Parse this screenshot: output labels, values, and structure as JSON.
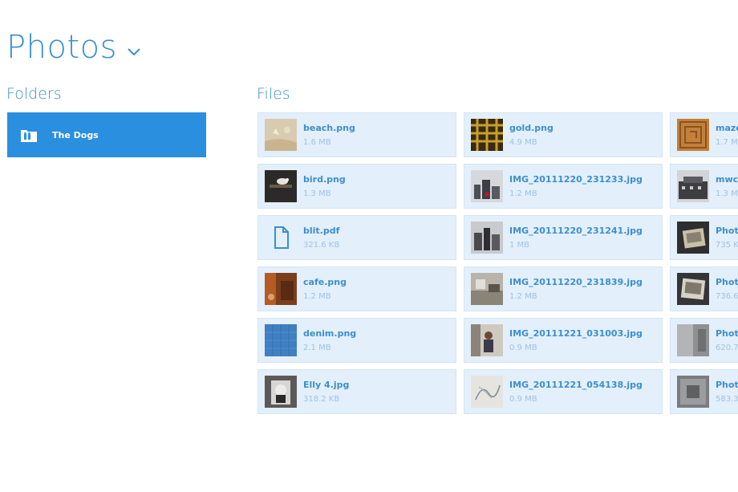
{
  "header": {
    "title": "Photos"
  },
  "sections": {
    "folders_label": "Folders",
    "files_label": "Files"
  },
  "folders": [
    {
      "name": "The Dogs",
      "icon": "folder-icon"
    }
  ],
  "colors": {
    "accent": "#2b8fe0",
    "text_blue": "#3b8fd0",
    "tile_bg": "#e3effa",
    "size_text": "#9dc3e6"
  },
  "files": [
    [
      {
        "name": "beach.png",
        "size": "1.6 MB",
        "thumb": "beach"
      },
      {
        "name": "bird.png",
        "size": "1.3 MB",
        "thumb": "bird"
      },
      {
        "name": "blit.pdf",
        "size": "321.6 KB",
        "thumb": "pdf"
      },
      {
        "name": "cafe.png",
        "size": "1.2 MB",
        "thumb": "cafe"
      },
      {
        "name": "denim.png",
        "size": "2.1 MB",
        "thumb": "denim"
      },
      {
        "name": "Elly 4.jpg",
        "size": "318.2 KB",
        "thumb": "elly"
      }
    ],
    [
      {
        "name": "gold.png",
        "size": "4.9 MB",
        "thumb": "gold"
      },
      {
        "name": "IMG_20111220_231233.jpg",
        "size": "1.2 MB",
        "thumb": "city1"
      },
      {
        "name": "IMG_20111220_231241.jpg",
        "size": "1 MB",
        "thumb": "city2"
      },
      {
        "name": "IMG_20111220_231839.jpg",
        "size": "1.2 MB",
        "thumb": "room"
      },
      {
        "name": "IMG_20111221_031003.jpg",
        "size": "0.9 MB",
        "thumb": "person"
      },
      {
        "name": "IMG_20111221_054138.jpg",
        "size": "0.9 MB",
        "thumb": "sketch"
      }
    ],
    [
      {
        "name": "maze",
        "size": "1.7 M",
        "thumb": "maze"
      },
      {
        "name": "mwc.",
        "size": "1.3 M",
        "thumb": "mwc"
      },
      {
        "name": "Photo",
        "size": "735 K",
        "thumb": "photo1"
      },
      {
        "name": "Photo",
        "size": "736.6",
        "thumb": "photo2"
      },
      {
        "name": "Photo",
        "size": "620.7",
        "thumb": "photo3"
      },
      {
        "name": "Photo",
        "size": "583.3",
        "thumb": "photo4"
      }
    ]
  ]
}
